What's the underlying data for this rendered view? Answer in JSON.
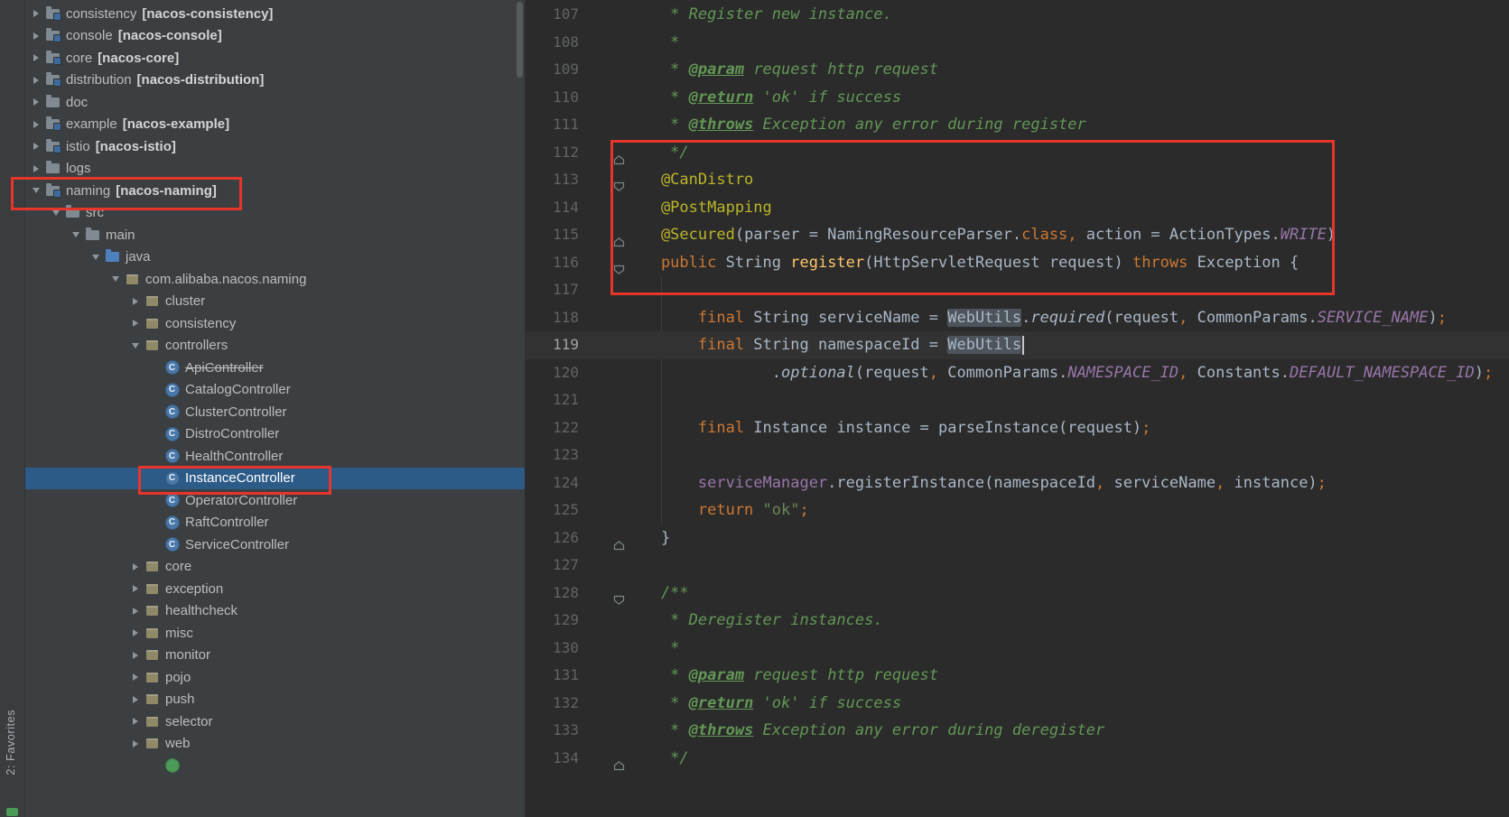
{
  "tool_strip": {
    "favorites_label": "2: Favorites"
  },
  "icons": {
    "class_letter": "C"
  },
  "project_tree": {
    "items": [
      {
        "label": "consistency",
        "suffix": "[nacos-consistency]",
        "level": 0,
        "arrow": "collapsed",
        "icon": "module-folder"
      },
      {
        "label": "console",
        "suffix": "[nacos-console]",
        "level": 0,
        "arrow": "collapsed",
        "icon": "module-folder"
      },
      {
        "label": "core",
        "suffix": "[nacos-core]",
        "level": 0,
        "arrow": "collapsed",
        "icon": "module-folder"
      },
      {
        "label": "distribution",
        "suffix": "[nacos-distribution]",
        "level": 0,
        "arrow": "collapsed",
        "icon": "module-folder"
      },
      {
        "label": "doc",
        "level": 0,
        "arrow": "collapsed",
        "icon": "folder"
      },
      {
        "label": "example",
        "suffix": "[nacos-example]",
        "level": 0,
        "arrow": "collapsed",
        "icon": "module-folder"
      },
      {
        "label": "istio",
        "suffix": "[nacos-istio]",
        "level": 0,
        "arrow": "collapsed",
        "icon": "module-folder"
      },
      {
        "label": "logs",
        "level": 0,
        "arrow": "collapsed",
        "icon": "folder"
      },
      {
        "label": "naming",
        "suffix": "[nacos-naming]",
        "level": 0,
        "arrow": "expanded",
        "icon": "module-folder"
      },
      {
        "label": "src",
        "level": 1,
        "arrow": "expanded",
        "icon": "folder"
      },
      {
        "label": "main",
        "level": 2,
        "arrow": "expanded",
        "icon": "folder"
      },
      {
        "label": "java",
        "level": 3,
        "arrow": "expanded",
        "icon": "source-folder"
      },
      {
        "label": "com.alibaba.nacos.naming",
        "level": 4,
        "arrow": "expanded",
        "icon": "package"
      },
      {
        "label": "cluster",
        "level": 5,
        "arrow": "collapsed",
        "icon": "package"
      },
      {
        "label": "consistency",
        "level": 5,
        "arrow": "collapsed",
        "icon": "package"
      },
      {
        "label": "controllers",
        "level": 5,
        "arrow": "expanded",
        "icon": "package"
      },
      {
        "label": "ApiController",
        "level": 6,
        "icon": "class",
        "deprecated": true
      },
      {
        "label": "CatalogController",
        "level": 6,
        "icon": "class"
      },
      {
        "label": "ClusterController",
        "level": 6,
        "icon": "class"
      },
      {
        "label": "DistroController",
        "level": 6,
        "icon": "class"
      },
      {
        "label": "HealthController",
        "level": 6,
        "icon": "class"
      },
      {
        "label": "InstanceController",
        "level": 6,
        "icon": "class",
        "selected": true
      },
      {
        "label": "OperatorController",
        "level": 6,
        "icon": "class"
      },
      {
        "label": "RaftController",
        "level": 6,
        "icon": "class"
      },
      {
        "label": "ServiceController",
        "level": 6,
        "icon": "class"
      },
      {
        "label": "core",
        "level": 5,
        "arrow": "collapsed",
        "icon": "package"
      },
      {
        "label": "exception",
        "level": 5,
        "arrow": "collapsed",
        "icon": "package"
      },
      {
        "label": "healthcheck",
        "level": 5,
        "arrow": "collapsed",
        "icon": "package"
      },
      {
        "label": "misc",
        "level": 5,
        "arrow": "collapsed",
        "icon": "package"
      },
      {
        "label": "monitor",
        "level": 5,
        "arrow": "collapsed",
        "icon": "package"
      },
      {
        "label": "pojo",
        "level": 5,
        "arrow": "collapsed",
        "icon": "package"
      },
      {
        "label": "push",
        "level": 5,
        "arrow": "collapsed",
        "icon": "package"
      },
      {
        "label": "selector",
        "level": 5,
        "arrow": "collapsed",
        "icon": "package"
      },
      {
        "label": "web",
        "level": 5,
        "arrow": "collapsed",
        "icon": "package"
      },
      {
        "label": "",
        "level": 6,
        "icon": "class-green",
        "partial": true
      }
    ]
  },
  "editor": {
    "lines": [
      {
        "n": 107,
        "seg": [
          [
            "cm",
            "     * Register new instance."
          ]
        ]
      },
      {
        "n": 108,
        "seg": [
          [
            "cm",
            "     *"
          ]
        ]
      },
      {
        "n": 109,
        "seg": [
          [
            "cm",
            "     * "
          ],
          [
            "tag",
            "@param"
          ],
          [
            "cm",
            " request http request"
          ]
        ]
      },
      {
        "n": 110,
        "seg": [
          [
            "cm",
            "     * "
          ],
          [
            "tag",
            "@return"
          ],
          [
            "cm",
            " 'ok' if success"
          ]
        ]
      },
      {
        "n": 111,
        "seg": [
          [
            "cm",
            "     * "
          ],
          [
            "tag",
            "@throws"
          ],
          [
            "cm",
            " Exception any error during register"
          ]
        ]
      },
      {
        "n": 112,
        "fold": "up",
        "seg": [
          [
            "cm",
            "     */"
          ]
        ]
      },
      {
        "n": 113,
        "fold": "down",
        "seg": [
          [
            "ann",
            "    @CanDistro"
          ]
        ]
      },
      {
        "n": 114,
        "seg": [
          [
            "ann",
            "    @PostMapping"
          ]
        ]
      },
      {
        "n": 115,
        "fold": "up",
        "seg": [
          [
            "ann",
            "    @Secured"
          ],
          [
            "d",
            "(parser = NamingResourceParser."
          ],
          [
            "k",
            "class"
          ],
          [
            "pt",
            ","
          ],
          [
            "d",
            " action = ActionTypes."
          ],
          [
            "cst",
            "WRITE"
          ],
          [
            "d",
            ")"
          ]
        ]
      },
      {
        "n": 116,
        "fold": "down",
        "seg": [
          [
            "k",
            "    public "
          ],
          [
            "d",
            "String "
          ],
          [
            "md",
            "register"
          ],
          [
            "d",
            "(HttpServletRequest request) "
          ],
          [
            "k",
            "throws "
          ],
          [
            "d",
            "Exception {"
          ]
        ]
      },
      {
        "n": 117,
        "seg": []
      },
      {
        "n": 118,
        "seg": [
          [
            "k",
            "        final "
          ],
          [
            "d",
            "String serviceName = "
          ],
          [
            "hl",
            "WebUtils"
          ],
          [
            "d",
            "."
          ],
          [
            "sm",
            "required"
          ],
          [
            "d",
            "(request"
          ],
          [
            "pt",
            ","
          ],
          [
            "d",
            " CommonParams."
          ],
          [
            "cst",
            "SERVICE_NAME"
          ],
          [
            "d",
            ")"
          ],
          [
            "pt",
            ";"
          ]
        ]
      },
      {
        "n": 119,
        "caret_line": true,
        "seg": [
          [
            "k",
            "        final "
          ],
          [
            "d",
            "String namespaceId = "
          ],
          [
            "hl",
            "WebUtils"
          ],
          [
            "caret",
            ""
          ]
        ]
      },
      {
        "n": 120,
        "seg": [
          [
            "d",
            "                ."
          ],
          [
            "sm",
            "optional"
          ],
          [
            "d",
            "(request"
          ],
          [
            "pt",
            ","
          ],
          [
            "d",
            " CommonParams."
          ],
          [
            "cst",
            "NAMESPACE_ID"
          ],
          [
            "pt",
            ","
          ],
          [
            "d",
            " Constants."
          ],
          [
            "cst",
            "DEFAULT_NAMESPACE_ID"
          ],
          [
            "d",
            ")"
          ],
          [
            "pt",
            ";"
          ]
        ]
      },
      {
        "n": 121,
        "seg": []
      },
      {
        "n": 122,
        "seg": [
          [
            "k",
            "        final "
          ],
          [
            "d",
            "Instance instance = parseInstance(request)"
          ],
          [
            "pt",
            ";"
          ]
        ]
      },
      {
        "n": 123,
        "seg": []
      },
      {
        "n": 124,
        "seg": [
          [
            "fld",
            "        serviceManager"
          ],
          [
            "d",
            ".registerInstance(namespaceId"
          ],
          [
            "pt",
            ","
          ],
          [
            "d",
            " serviceName"
          ],
          [
            "pt",
            ","
          ],
          [
            "d",
            " instance)"
          ],
          [
            "pt",
            ";"
          ]
        ]
      },
      {
        "n": 125,
        "seg": [
          [
            "k",
            "        return "
          ],
          [
            "s",
            "\"ok\""
          ],
          [
            "pt",
            ";"
          ]
        ]
      },
      {
        "n": 126,
        "fold": "up",
        "seg": [
          [
            "d",
            "    }"
          ]
        ]
      },
      {
        "n": 127,
        "seg": []
      },
      {
        "n": 128,
        "fold": "down",
        "seg": [
          [
            "cm",
            "    /**"
          ]
        ]
      },
      {
        "n": 129,
        "seg": [
          [
            "cm",
            "     * Deregister instances."
          ]
        ]
      },
      {
        "n": 130,
        "seg": [
          [
            "cm",
            "     *"
          ]
        ]
      },
      {
        "n": 131,
        "seg": [
          [
            "cm",
            "     * "
          ],
          [
            "tag",
            "@param"
          ],
          [
            "cm",
            " request http request"
          ]
        ]
      },
      {
        "n": 132,
        "seg": [
          [
            "cm",
            "     * "
          ],
          [
            "tag",
            "@return"
          ],
          [
            "cm",
            " 'ok' if success"
          ]
        ]
      },
      {
        "n": 133,
        "seg": [
          [
            "cm",
            "     * "
          ],
          [
            "tag",
            "@throws"
          ],
          [
            "cm",
            " Exception any error during deregister"
          ]
        ]
      },
      {
        "n": 134,
        "fold": "up",
        "seg": [
          [
            "cm",
            "     */"
          ]
        ]
      }
    ]
  }
}
